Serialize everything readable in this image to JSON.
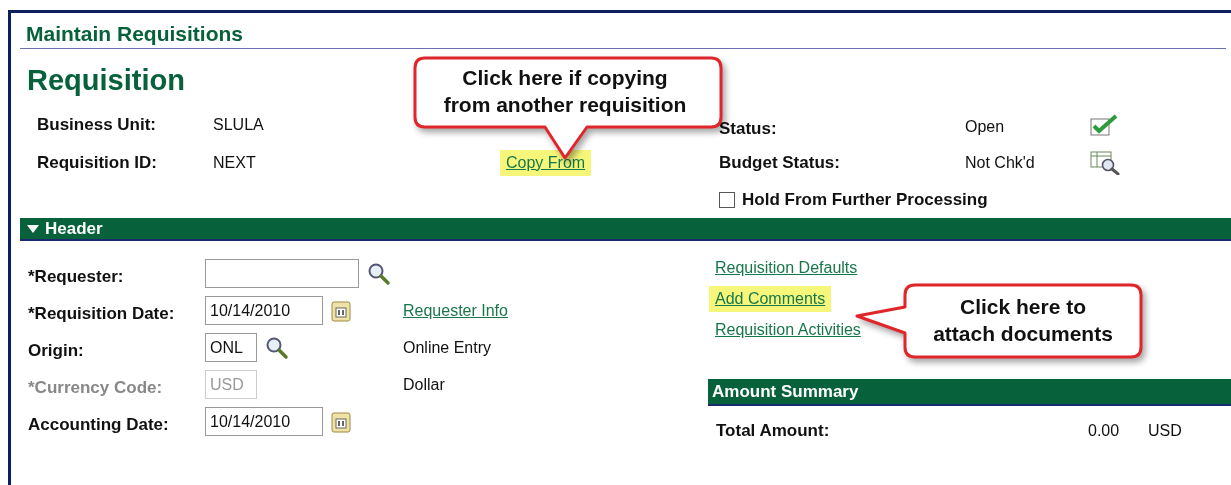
{
  "window": {
    "title": "Maintain Requisitions"
  },
  "page_title": "Requisition",
  "summary_fields": [
    {
      "label": "Business Unit:",
      "value": "SLULA"
    },
    {
      "label": "Requisition ID:",
      "value": "NEXT"
    }
  ],
  "copy_from": {
    "label": "Copy From",
    "highlighted": true
  },
  "status_fields": [
    {
      "label": "Status:",
      "value": "Open",
      "kind": "check"
    },
    {
      "label": "Budget Status:",
      "value": "Not Chk'd",
      "kind": "budget"
    }
  ],
  "hold": {
    "label": "Hold From Further Processing",
    "checked": false
  },
  "header_section": {
    "title": "Header",
    "expanded": true
  },
  "form_fields": [
    {
      "label": "*Requester:",
      "kind": "lookup",
      "disabled": false
    },
    {
      "label": "*Requisition Date:",
      "kind": "date",
      "value": "10/14/2010",
      "disabled": false,
      "link": "Requester Info"
    },
    {
      "label": "Origin:",
      "kind": "lookup",
      "value": "ONL",
      "disabled": false,
      "description": "Online Entry"
    },
    {
      "label": "*Currency Code:",
      "kind": "text",
      "value": "USD",
      "disabled": true,
      "description": "Dollar"
    },
    {
      "label": "Accounting Date:",
      "kind": "date",
      "value": "10/14/2010",
      "disabled": false
    }
  ],
  "links": [
    {
      "label": "Requisition Defaults",
      "highlighted": false
    },
    {
      "label": "Add Comments",
      "highlighted": true
    },
    {
      "label": "Requisition Activities",
      "highlighted": false
    }
  ],
  "amount_summary": {
    "title": "Amount Summary",
    "rows": [
      {
        "label": "Total Amount:",
        "value": "0.00",
        "currency": "USD"
      }
    ]
  },
  "callouts": [
    {
      "text": "Click here if copying\nfrom another requisition",
      "kind": "down"
    },
    {
      "text": "Click here to\nattach documents",
      "kind": "left"
    }
  ]
}
